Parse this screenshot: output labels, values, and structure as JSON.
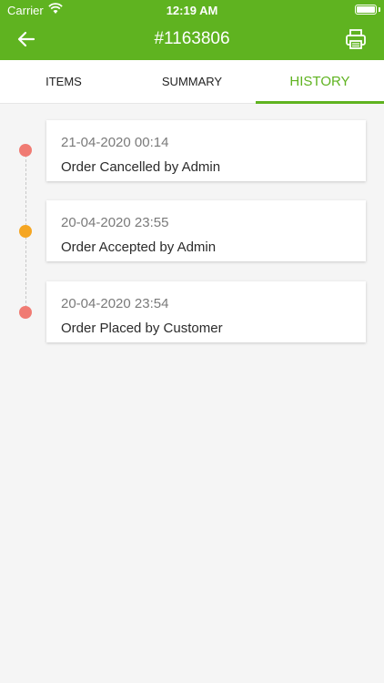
{
  "status_bar": {
    "carrier": "Carrier",
    "time": "12:19 AM"
  },
  "header": {
    "title": "#1163806",
    "back_icon": "arrow-left-icon",
    "print_icon": "printer-icon"
  },
  "tabs": [
    {
      "label": "ITEMS",
      "active": false
    },
    {
      "label": "SUMMARY",
      "active": false
    },
    {
      "label": "HISTORY",
      "active": true
    }
  ],
  "history": [
    {
      "date": "21-04-2020 00:14",
      "message": "Order Cancelled by Admin",
      "dot_color": "#f07b73"
    },
    {
      "date": "20-04-2020 23:55",
      "message": "Order Accepted by Admin",
      "dot_color": "#f5a623"
    },
    {
      "date": "20-04-2020 23:54",
      "message": "Order Placed by Customer",
      "dot_color": "#f07b73"
    }
  ],
  "colors": {
    "accent": "#5fb320",
    "background": "#f5f5f5"
  }
}
